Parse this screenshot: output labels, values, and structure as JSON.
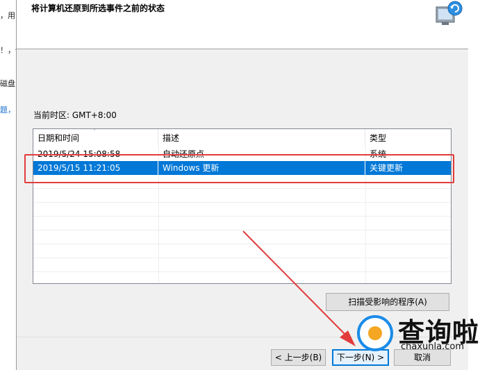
{
  "background_window": {
    "snippets": [
      "，用",
      "！，但",
      "磁盘",
      "题，"
    ]
  },
  "dialog": {
    "title": "将计算机还原到所选事件之前的状态",
    "timezone": "当前时区: GMT+8:00",
    "table": {
      "columns": [
        "日期和时间",
        "描述",
        "类型"
      ],
      "rows": [
        {
          "datetime": "2019/5/24 15:08:58",
          "description": "自动还原点",
          "type": "系统"
        },
        {
          "datetime": "2019/5/15 11:21:05",
          "description": "Windows 更新",
          "type": "关键更新",
          "selected": true
        }
      ]
    },
    "scan_button": "扫描受影响的程序(A)",
    "back_button": "< 上一步(B)",
    "next_button": "下一步(N) >",
    "cancel_button": "取消"
  },
  "watermark": {
    "brand": "查询啦",
    "url": "chaxunla.com"
  },
  "colors": {
    "selection": "#0078d7",
    "annotation": "#e23b3b",
    "watermark_blue": "#1a8be8"
  }
}
